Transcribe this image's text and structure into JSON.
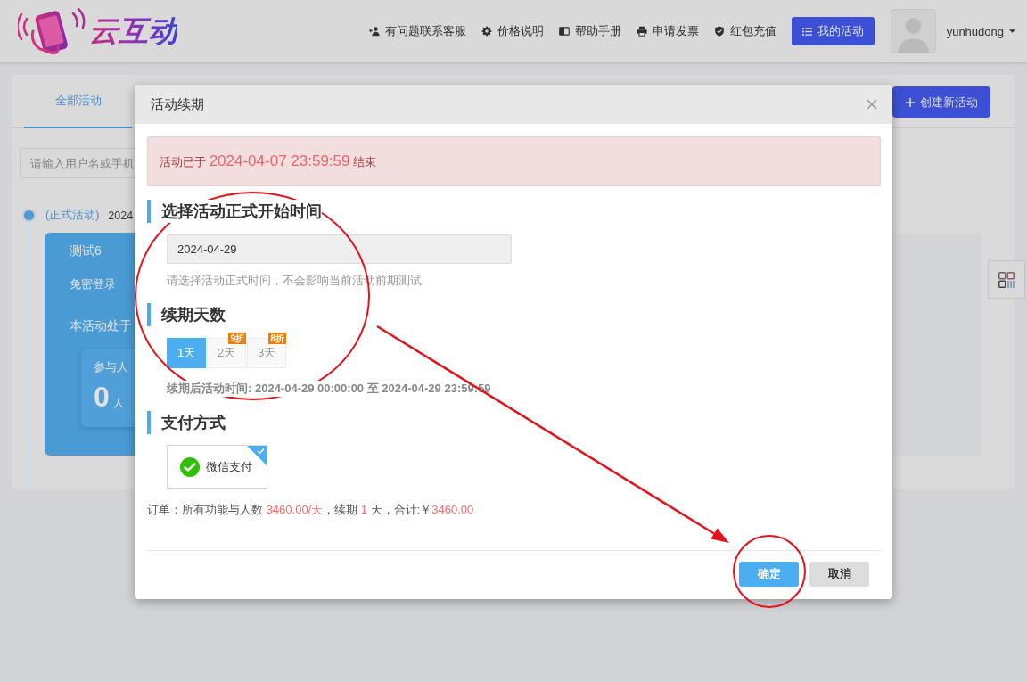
{
  "header": {
    "logo": "云互动",
    "nav": [
      {
        "label": "有问题联系客服"
      },
      {
        "label": "价格说明"
      },
      {
        "label": "帮助手册"
      },
      {
        "label": "申请发票"
      },
      {
        "label": "红包充值"
      }
    ],
    "my_activities": "我的活动",
    "username": "yunhudong"
  },
  "panel": {
    "tabs": [
      {
        "label": "全部活动",
        "selected": true
      }
    ],
    "create_button": "创建新活动",
    "search": {
      "placeholder": "请输入用户名或手机"
    },
    "timeline": [
      {
        "type": "(正式活动)",
        "date": "2024",
        "title": "测试6",
        "login_mode": "免密登录",
        "status_prefix": "本活动处于",
        "stat_label": "参与人",
        "stat_value": "0",
        "stat_unit": "人"
      }
    ]
  },
  "modal": {
    "title": "活动续期",
    "notice": {
      "prefix": "活动已于",
      "date": "2024-04-07 23:59:59",
      "suffix": "结束"
    },
    "start_section": {
      "title": "选择活动正式开始时间",
      "date_value": "2024-04-29",
      "hint": "请选择活动正式时间，不会影响当前活动前期测试"
    },
    "days_section": {
      "title": "续期天数",
      "options": [
        {
          "label": "1天",
          "selected": true
        },
        {
          "label": "2天",
          "selected": false,
          "badge": "9折"
        },
        {
          "label": "3天",
          "selected": false,
          "badge": "8折"
        }
      ],
      "result": "续期后活动时间: 2024-04-29 00:00:00 至 2024-04-29 23:59:59"
    },
    "payment_section": {
      "title": "支付方式",
      "methods": [
        {
          "label": "微信支付",
          "selected": true
        }
      ]
    },
    "order": {
      "label": "订单：所有功能与人数",
      "unit_price": "3460.00/天",
      "period_label": "，续期",
      "days": "1",
      "total_label": "天，合计:￥",
      "total": "3460.00"
    },
    "buttons": [
      {
        "kind": "primary",
        "label": "确定"
      },
      {
        "kind": "secondary",
        "label": "取消"
      }
    ]
  }
}
